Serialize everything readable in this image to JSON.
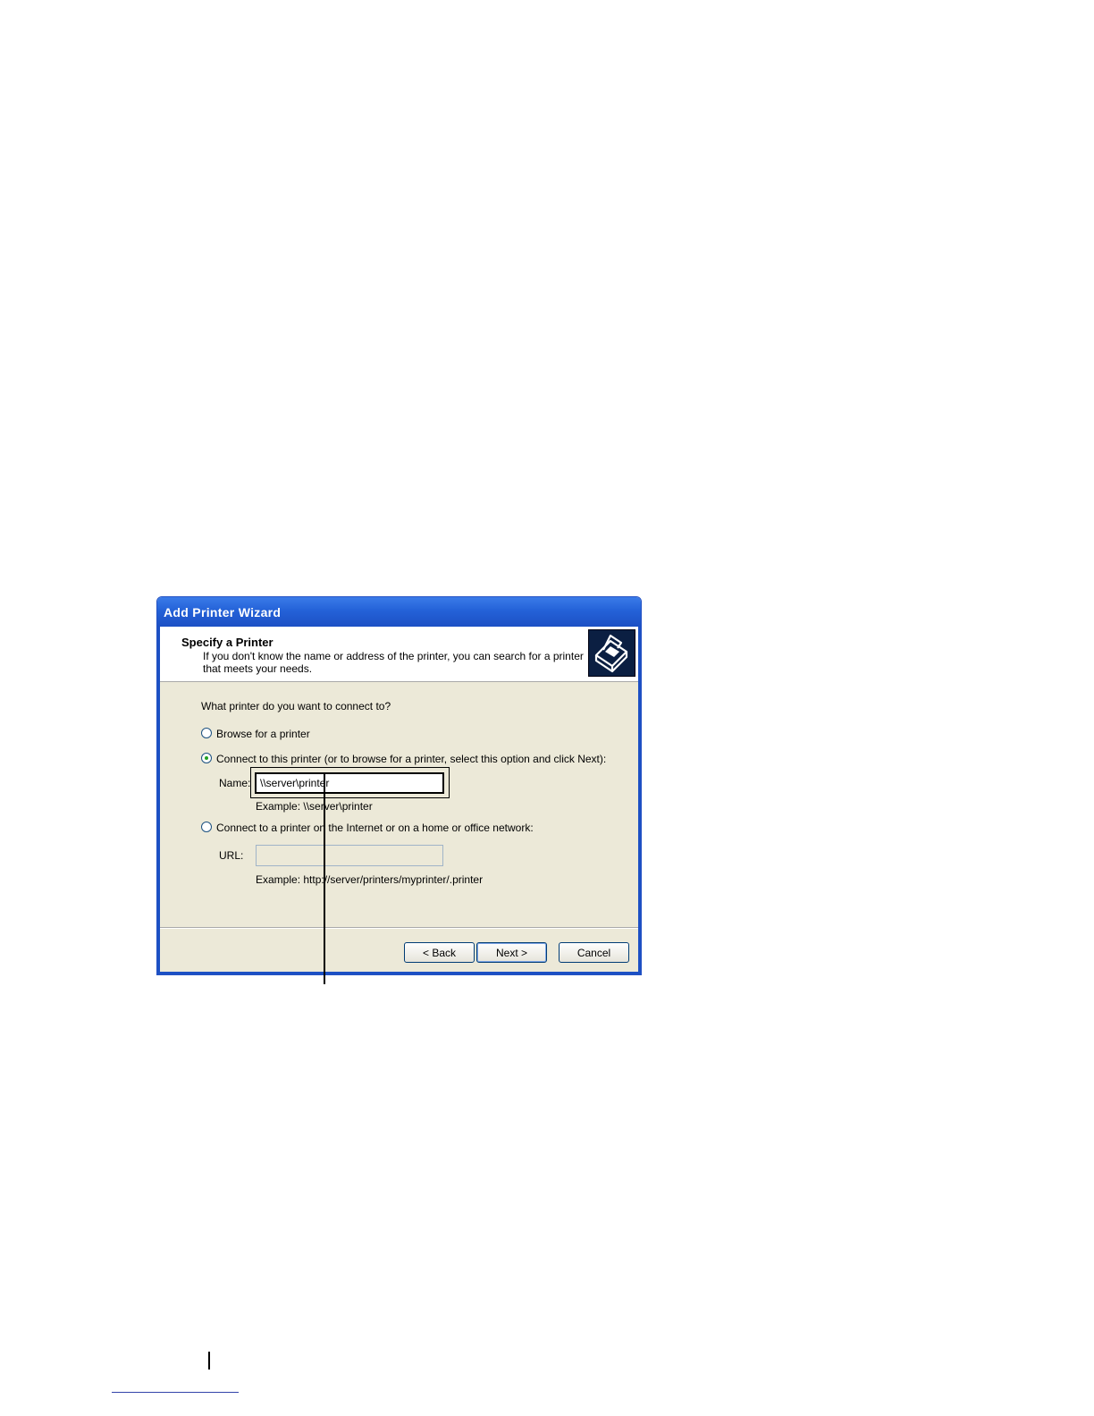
{
  "dialog": {
    "title": "Add Printer Wizard",
    "header": {
      "title": "Specify a Printer",
      "description": "If you don't know the name or address of the printer, you can search for a printer that meets your needs.",
      "icon": "printer-icon"
    },
    "question": "What printer do you want to connect to?",
    "options": {
      "browse": {
        "label": "Browse for a printer",
        "checked": false
      },
      "connect": {
        "label": "Connect to this printer (or to browse for a printer, select this option and click Next):",
        "checked": true
      },
      "internet": {
        "label": "Connect to a printer on the Internet or on a home or office network:",
        "checked": false
      }
    },
    "name_field": {
      "label": "Name:",
      "value": "\\\\server\\printer",
      "example": "Example: \\\\server\\printer"
    },
    "url_field": {
      "label": "URL:",
      "value": "",
      "example": "Example: http://server/printers/myprinter/.printer"
    },
    "buttons": {
      "back": "< Back",
      "next": "Next >",
      "cancel": "Cancel"
    }
  }
}
